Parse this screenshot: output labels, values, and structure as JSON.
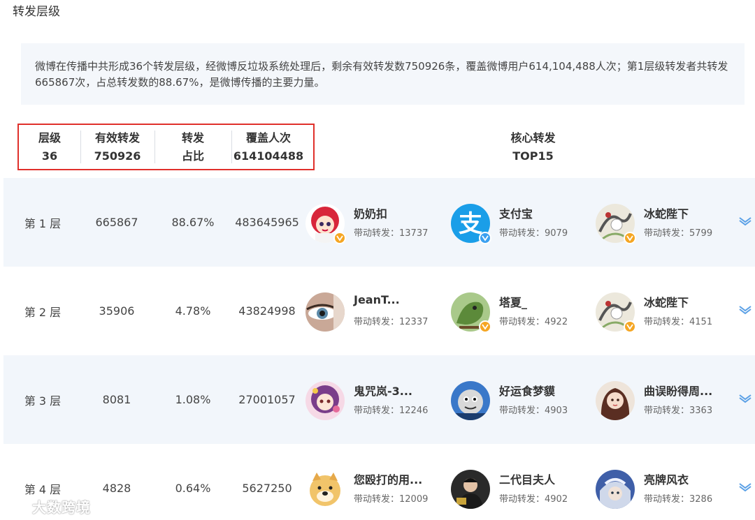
{
  "section_title": "转发层级",
  "summary": "微博在传播中共形成36个转发层级，经微博反垃圾系统处理后，剩余有效转发数750926条，覆盖微博用户614,104,488人次；第1层级转发者共转发665867次，占总转发数的88.67%，是微博传播的主要力量。",
  "stats_header": {
    "level_label": "层级",
    "level_value": "36",
    "forward_label": "有效转发",
    "forward_value": "750926",
    "ratio_label": "转发",
    "ratio_value": "占比",
    "cover_label": "覆盖人次",
    "cover_value": "614104488"
  },
  "core_header": {
    "line1": "核心转发",
    "line2": "TOP15"
  },
  "layers": [
    {
      "level": "第 1 层",
      "forward": "665867",
      "ratio": "88.67%",
      "cover": "483645965",
      "users": [
        {
          "name": "奶奶扣",
          "label": "带动转发：",
          "count": "13737",
          "badge": "gold",
          "avatar": "anime-red-hair-avatar"
        },
        {
          "name": "支付宝",
          "label": "带动转发：",
          "count": "9079",
          "badge": "blue",
          "avatar": "alipay-logo-avatar"
        },
        {
          "name": "冰蛇陛下",
          "label": "带动转发：",
          "count": "5799",
          "badge": "gold",
          "avatar": "ink-painting-avatar"
        }
      ]
    },
    {
      "level": "第 2 层",
      "forward": "35906",
      "ratio": "4.78%",
      "cover": "43824998",
      "users": [
        {
          "name": "JeanT...",
          "label": "带动转发：",
          "count": "12337",
          "badge": "none",
          "avatar": "eye-closeup-avatar"
        },
        {
          "name": "塔夏_",
          "label": "带动转发：",
          "count": "4922",
          "badge": "gold",
          "avatar": "green-dragon-avatar"
        },
        {
          "name": "冰蛇陛下",
          "label": "带动转发：",
          "count": "4151",
          "badge": "gold",
          "avatar": "ink-painting-avatar"
        }
      ]
    },
    {
      "level": "第 3 层",
      "forward": "8081",
      "ratio": "1.08%",
      "cover": "27001057",
      "users": [
        {
          "name": "鬼咒岚-3...",
          "label": "带动转发：",
          "count": "12246",
          "badge": "none",
          "avatar": "anime-girl-avatar"
        },
        {
          "name": "好运食梦貘",
          "label": "带动转发：",
          "count": "4903",
          "badge": "none",
          "avatar": "train-cartoon-avatar"
        },
        {
          "name": "曲误盼得周...",
          "label": "带动转发：",
          "count": "3363",
          "badge": "none",
          "avatar": "illustrated-girl-avatar"
        }
      ]
    },
    {
      "level": "第 4 层",
      "forward": "4828",
      "ratio": "0.64%",
      "cover": "5627250",
      "users": [
        {
          "name": "您殴打的用...",
          "label": "带动转发：",
          "count": "12009",
          "badge": "none",
          "avatar": "doge-avatar"
        },
        {
          "name": "二代目夫人",
          "label": "带动转发：",
          "count": "4902",
          "badge": "none",
          "avatar": "man-portrait-avatar"
        },
        {
          "name": "亮牌风衣",
          "label": "带动转发：",
          "count": "3286",
          "badge": "none",
          "avatar": "blue-character-avatar"
        }
      ]
    }
  ],
  "watermark": "大数跨境",
  "colors": {
    "accent_border": "#e0302b",
    "row_shade": "#f2f6fb",
    "expand_icon": "#5aa0e6",
    "verified_gold": "#f5a623",
    "verified_blue": "#3ba0f0"
  }
}
